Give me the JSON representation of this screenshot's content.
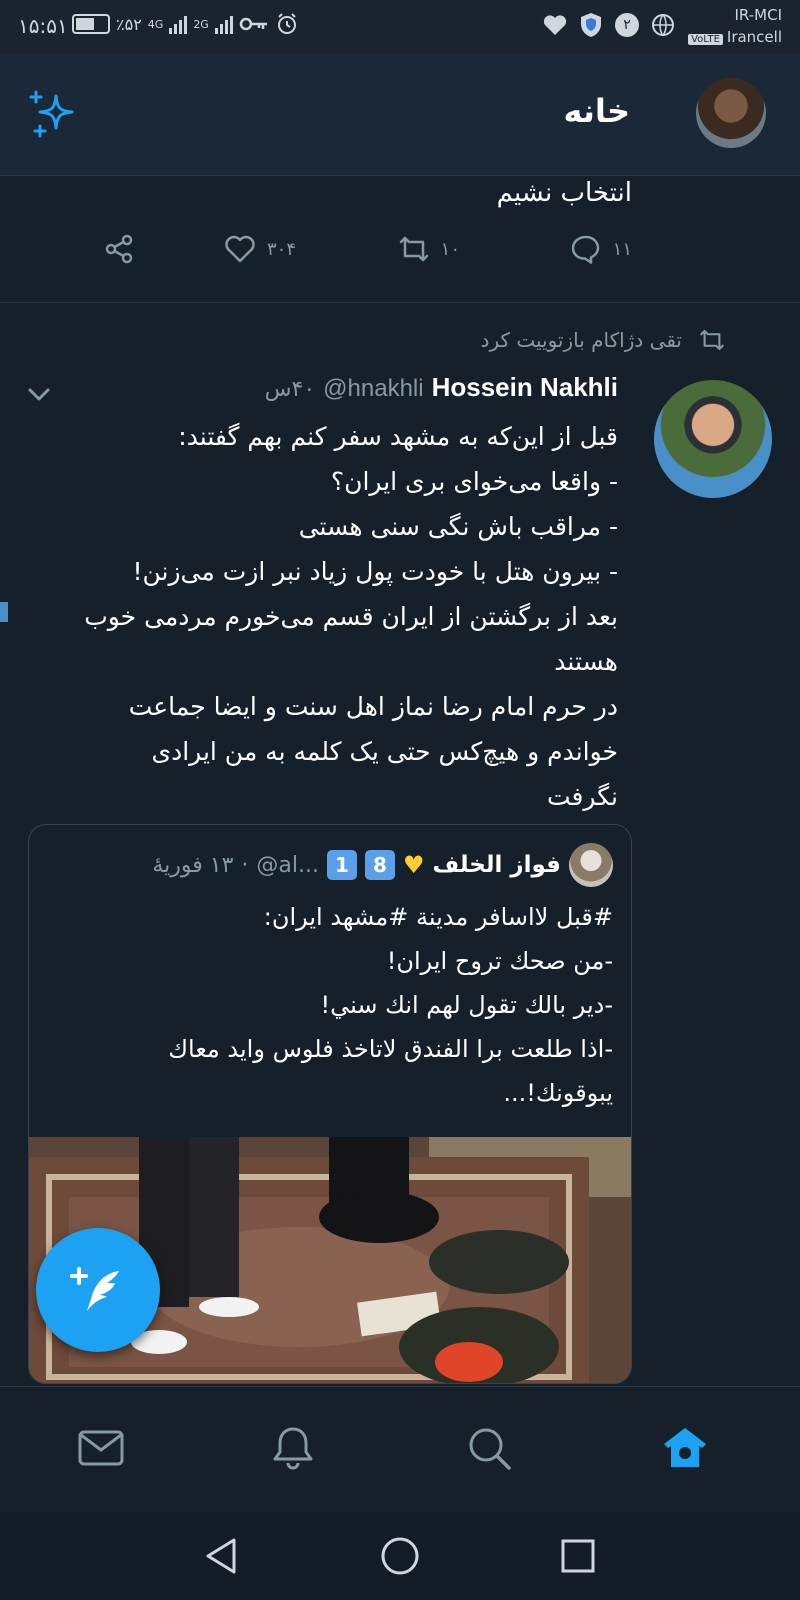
{
  "status_bar": {
    "time": "۱۵:۵۱",
    "battery": "٪۵۲",
    "network_4g": "4G",
    "network_2g": "2G",
    "notification_count": "۲",
    "carrier_top": "IR-MCI",
    "volte": "VoLTE",
    "carrier_bottom": "Irancell"
  },
  "header": {
    "title": "خانه"
  },
  "tweet_prev": {
    "text_tail": "انتخاب نشیم",
    "reply_count": "۱۱",
    "retweet_count": "۱۰",
    "like_count": "۳۰۴"
  },
  "tweet": {
    "retweeted_by": "تقی دژاکام بازتوییت کرد",
    "author_name": "Hossein Nakhli",
    "handle": "@hnakhli",
    "time": "۴۰س",
    "lines": [
      "قبل از این‌که به مشهد سفر کنم بهم گفتند:",
      "- واقعا می‌خوای بری ایران؟",
      "- مراقب باش نگی سنی هستی",
      "- بیرون هتل با خودت پول زیاد نبر ازت می‌زنن!",
      "بعد از برگشتن از ایران قسم می‌خورم مردمی خوب",
      "هستند",
      "در حرم امام رضا نماز اهل سنت و ایضا جماعت",
      "خواندم و هیچ‌کس حتی یک کلمه به من ایرادی",
      "نگرفت"
    ]
  },
  "quote": {
    "author_name": "فواز الخلف",
    "keycap_1": "1",
    "keycap_2": "8",
    "handle": "@al...",
    "date": "۱۳ فوریهٔ",
    "lines": [
      "#قبل لااسافر مدينة #مشهد ايران:",
      "-من صحك تروح ايران!",
      "-دير بالك تقول لهم انك سني!",
      "-اذا طلعت برا الفندق لاتاخذ فلوس وايد معاك",
      "يبوقونك!..."
    ]
  },
  "colors": {
    "background": "#15202b",
    "accent": "#1da1f2",
    "muted": "#8899a6",
    "border": "#38444d"
  },
  "icons": {
    "header_left": "sparkle-icon",
    "fab": "compose-tweet-icon",
    "tabs": [
      "mail-icon",
      "bell-icon",
      "search-icon",
      "home-icon"
    ],
    "nav": [
      "back-icon",
      "home-circle-icon",
      "recents-icon"
    ]
  }
}
